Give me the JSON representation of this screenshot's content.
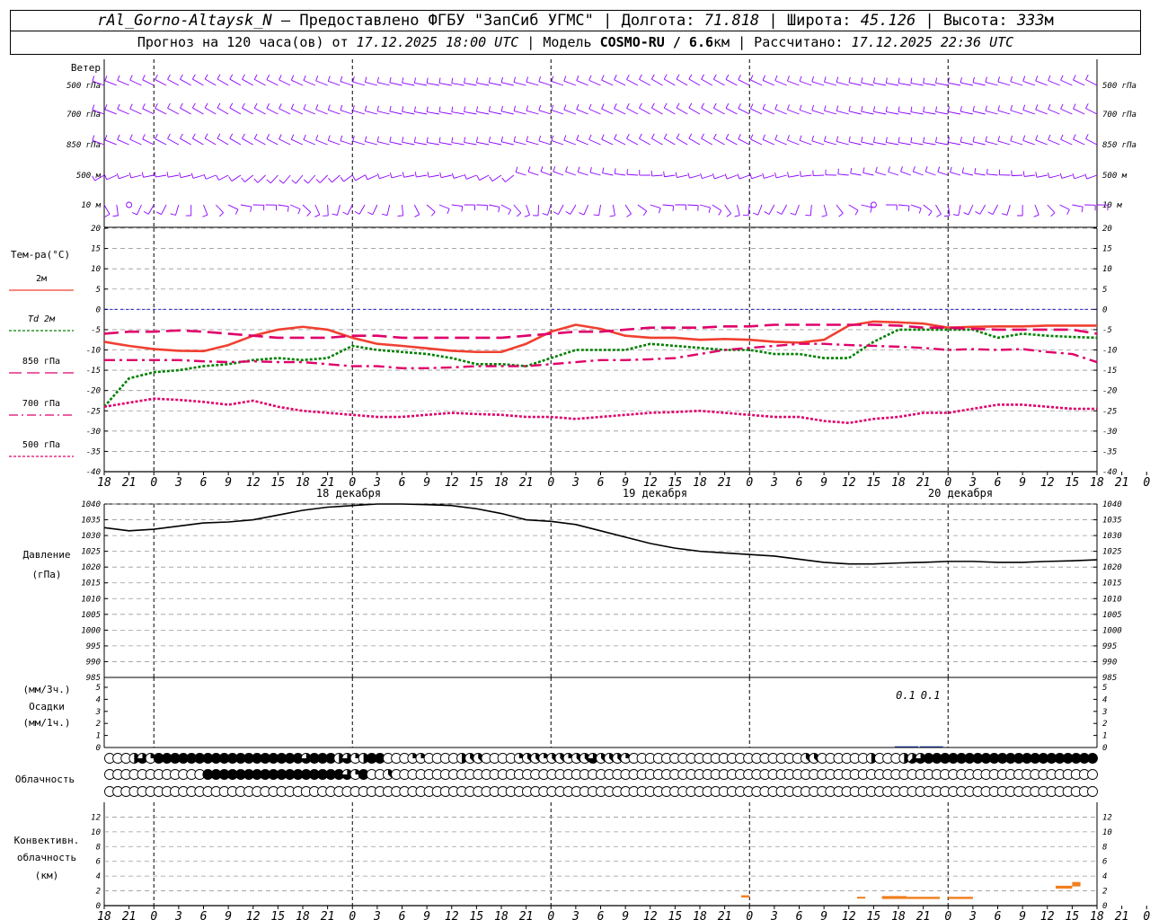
{
  "header": {
    "station": "rAl_Gorno-Altaysk_N",
    "dash": " – ",
    "provider": "Предоставлено ФГБУ \"ЗапСиб УГМС\"",
    "lon_label": "Долгота: ",
    "lon_value": "71.818",
    "lat_label": "Широта: ",
    "lat_value": "45.126",
    "alt_label": "Высота: ",
    "alt_value": "333",
    "alt_unit": "м",
    "sep": " | ",
    "forecast_prefix": "Прогноз на 120 часа(ов) от ",
    "forecast_start": "17.12.2025 18:00 UTC",
    "model_prefix": "  | Модель ",
    "model_name": "COSMO-RU / 6.6",
    "model_unit": "км",
    "calc_prefix": " | Рассчитано: ",
    "calc_time": "17.12.2025 22:36 UTC"
  },
  "colors": {
    "wind": "#8b00ff",
    "t2m": "#f04030",
    "td2m": "#008000",
    "t850": "#e0006a",
    "t700": "#e0006a",
    "t500": "#e0006a",
    "pressure": "#000000",
    "precip": "#2040c0",
    "conv": "#f08020",
    "grid": "#999999",
    "zero": "#0000cc"
  },
  "chart_data": [
    {
      "type": "wind_barbs",
      "panel_label": "Ветер",
      "levels": [
        "500 гПа",
        "700 гПа",
        "850 гПа",
        "500 м",
        "10  м"
      ]
    },
    {
      "type": "line",
      "panel_label": "Тем-ра(°С)",
      "ylim": [
        -40,
        20
      ],
      "yticks": [
        20,
        15,
        10,
        5,
        0,
        -5,
        -10,
        -15,
        -20,
        -25,
        -30,
        -35,
        -40
      ],
      "x_hours": [
        0,
        3,
        6,
        9,
        12,
        15,
        18,
        21,
        24,
        27,
        30,
        33,
        36,
        39,
        42,
        45,
        48,
        51,
        54,
        57,
        60,
        63,
        66,
        69,
        72,
        75,
        78,
        81,
        84,
        87,
        90,
        93,
        96,
        99,
        102,
        105,
        108,
        111,
        114,
        117,
        120
      ],
      "series": [
        {
          "name": "2м",
          "key": "t2m",
          "values": [
            -8,
            -9,
            -9.8,
            -10.2,
            -10.3,
            -8.8,
            -6.5,
            -5,
            -4.3,
            -5,
            -7,
            -8.5,
            -9,
            -9.6,
            -10.2,
            -10.5,
            -10.5,
            -8.5,
            -5.5,
            -3.8,
            -4.8,
            -6.5,
            -7,
            -7,
            -7.5,
            -7.3,
            -7.5,
            -8,
            -8.2,
            -7.5,
            -4,
            -3,
            -3.2,
            -3.5,
            -4.5,
            -4.3,
            -4.2,
            -4.2,
            -4,
            -4,
            -4
          ]
        },
        {
          "name": "Td  2м",
          "key": "td2m",
          "values": [
            -24,
            -17,
            -15.5,
            -15,
            -14,
            -13.5,
            -12.5,
            -12,
            -12.5,
            -12,
            -9,
            -10,
            -10.5,
            -11,
            -12,
            -13.5,
            -13.5,
            -14,
            -12,
            -10,
            -10,
            -10,
            -8.5,
            -9,
            -9.5,
            -10,
            -10,
            -11,
            -11,
            -12,
            -12,
            -8,
            -5,
            -5,
            -5,
            -5,
            -7,
            -6,
            -6.5,
            -6.8,
            -7
          ]
        },
        {
          "name": "850 гПа",
          "key": "t850",
          "values": [
            -6,
            -5.5,
            -5.5,
            -5.2,
            -5.5,
            -6,
            -6.5,
            -7,
            -7,
            -7,
            -6.5,
            -6.5,
            -7,
            -7,
            -7,
            -7,
            -7,
            -6.5,
            -6,
            -5.5,
            -5.5,
            -5,
            -4.5,
            -4.5,
            -4.5,
            -4.2,
            -4.2,
            -3.8,
            -3.8,
            -3.8,
            -3.8,
            -3.8,
            -4,
            -4.5,
            -4.5,
            -4.8,
            -5,
            -5,
            -5,
            -5,
            -6
          ]
        },
        {
          "name": "700 гПа",
          "key": "t700",
          "values": [
            -12.5,
            -12.5,
            -12.5,
            -12.5,
            -12.8,
            -13,
            -12.8,
            -13,
            -13,
            -13.5,
            -14,
            -14,
            -14.5,
            -14.5,
            -14.3,
            -14,
            -14,
            -14,
            -13.5,
            -13,
            -12.5,
            -12.5,
            -12.3,
            -12,
            -11,
            -10,
            -9.5,
            -9,
            -8.5,
            -8.5,
            -8.8,
            -9,
            -9.2,
            -9.5,
            -10,
            -9.8,
            -10,
            -9.8,
            -10.5,
            -11,
            -13
          ]
        },
        {
          "name": "500 гПа",
          "key": "t500",
          "values": [
            -24,
            -23,
            -22,
            -22.3,
            -22.8,
            -23.5,
            -22.5,
            -24,
            -25,
            -25.5,
            -26,
            -26.5,
            -26.5,
            -26,
            -25.5,
            -25.8,
            -26,
            -26.5,
            -26.5,
            -27,
            -26.5,
            -26,
            -25.5,
            -25.3,
            -25,
            -25.5,
            -26,
            -26.5,
            -26.5,
            -27.5,
            -28,
            -27,
            -26.5,
            -25.5,
            -25.5,
            -24.5,
            -23.5,
            -23.5,
            -24,
            -24.5,
            -24.5
          ]
        }
      ]
    },
    {
      "type": "line",
      "panel_label": "Давление",
      "panel_unit": "(гПа)",
      "ylim": [
        985,
        1040
      ],
      "yticks": [
        1040,
        1035,
        1030,
        1025,
        1020,
        1015,
        1010,
        1005,
        1000,
        995,
        990,
        985
      ],
      "x_hours": [
        0,
        3,
        6,
        9,
        12,
        15,
        18,
        21,
        24,
        27,
        30,
        33,
        36,
        39,
        42,
        45,
        48,
        51,
        54,
        57,
        60,
        63,
        66,
        69,
        72,
        75,
        78,
        81,
        84,
        87,
        90,
        93,
        96,
        99,
        102,
        105,
        108,
        111,
        114,
        117,
        120
      ],
      "series": [
        {
          "name": "pressure",
          "key": "pressure",
          "values": [
            1032.5,
            1031.5,
            1032,
            1033,
            1034,
            1034.3,
            1035,
            1036.5,
            1038,
            1039,
            1039.5,
            1040,
            1040,
            1039.8,
            1039.5,
            1038.5,
            1037,
            1035,
            1034.5,
            1033.5,
            1031.5,
            1029.5,
            1027.5,
            1026,
            1025,
            1024.5,
            1024,
            1023.5,
            1022.5,
            1021.5,
            1021,
            1021,
            1021.3,
            1021.5,
            1021.8,
            1021.8,
            1021.5,
            1021.5,
            1021.8,
            1022,
            1022.3
          ]
        }
      ]
    },
    {
      "type": "bar",
      "panel_label_1": "(мм/3ч.)",
      "panel_label_2": "Осадки",
      "panel_label_3": "(мм/1ч.)",
      "ylim": [
        0,
        5
      ],
      "yticks": [
        5,
        4,
        3,
        2,
        1,
        0
      ],
      "x_hours": [
        96,
        99
      ],
      "values": [
        0.1,
        0.1
      ],
      "labels": [
        "0.1",
        "0.1"
      ]
    },
    {
      "type": "cloud_cover",
      "panel_label": "Облачность",
      "rows_note": "octas per hour, 3 levels",
      "rows": [
        [
          0,
          0,
          0,
          4,
          6,
          2,
          8,
          8,
          8,
          8,
          8,
          8,
          8,
          8,
          8,
          8,
          8,
          8,
          8,
          8,
          8,
          8,
          8,
          8,
          6,
          8,
          8,
          8,
          4,
          6,
          2,
          4,
          8,
          8,
          0,
          0,
          0,
          2,
          2,
          0,
          0,
          0,
          0,
          4,
          3,
          3,
          0,
          0,
          0,
          0,
          2,
          3,
          3,
          2,
          3,
          3,
          2,
          3,
          3,
          6,
          3,
          3,
          3,
          2,
          0,
          0,
          0,
          0,
          0,
          0,
          0,
          0,
          0,
          0,
          0,
          0,
          0,
          0,
          0,
          0,
          0,
          0,
          0,
          0,
          0,
          3,
          3,
          0,
          0,
          0,
          0,
          0,
          0,
          4,
          0,
          0,
          0,
          4,
          5,
          6,
          8,
          8,
          8,
          8,
          8,
          8,
          8,
          8,
          8,
          8,
          8,
          8,
          8,
          8,
          8,
          8,
          8,
          8,
          8,
          8,
          8
        ],
        [
          0,
          0,
          0,
          0,
          0,
          0,
          0,
          0,
          0,
          0,
          0,
          0,
          8,
          8,
          8,
          8,
          8,
          8,
          8,
          8,
          8,
          8,
          8,
          8,
          8,
          8,
          8,
          8,
          8,
          6,
          2,
          8,
          0,
          0,
          3,
          0,
          0,
          0,
          0,
          0,
          0,
          0,
          0,
          0,
          0,
          0,
          0,
          0,
          0,
          0,
          0,
          0,
          0,
          0,
          0,
          0,
          0,
          0,
          0,
          0,
          0,
          0,
          0,
          0,
          0,
          0,
          0,
          0,
          0,
          0,
          0,
          0,
          0,
          0,
          0,
          0,
          0,
          0,
          0,
          0,
          0,
          0,
          0,
          0,
          0,
          0,
          0,
          0,
          0,
          0,
          0,
          0,
          0,
          0,
          0,
          0,
          0,
          0,
          0,
          0,
          0,
          0,
          0,
          0,
          0,
          0,
          0,
          0,
          0,
          0,
          0,
          0,
          0,
          0,
          0,
          0,
          0,
          0,
          0,
          0,
          0
        ],
        [
          0,
          0,
          0,
          0,
          0,
          0,
          0,
          0,
          0,
          0,
          0,
          0,
          0,
          0,
          0,
          0,
          0,
          0,
          0,
          0,
          0,
          0,
          0,
          0,
          0,
          0,
          0,
          0,
          0,
          0,
          0,
          0,
          0,
          0,
          0,
          0,
          0,
          0,
          0,
          0,
          0,
          0,
          0,
          0,
          0,
          0,
          0,
          0,
          0,
          0,
          0,
          0,
          0,
          0,
          0,
          0,
          0,
          0,
          0,
          0,
          0,
          0,
          0,
          0,
          0,
          0,
          0,
          0,
          0,
          0,
          0,
          0,
          0,
          0,
          0,
          0,
          0,
          0,
          0,
          0,
          0,
          0,
          0,
          0,
          0,
          0,
          0,
          0,
          0,
          0,
          0,
          0,
          0,
          0,
          0,
          0,
          0,
          0,
          0,
          0,
          0,
          0,
          0,
          0,
          0,
          0,
          0,
          0,
          0,
          0,
          0,
          0,
          0,
          0,
          0,
          0,
          0,
          0,
          0,
          0,
          0
        ]
      ]
    },
    {
      "type": "bar",
      "panel_label_1": "Конвективн.",
      "panel_label_2": "облачность",
      "panel_label_3": "(км)",
      "ylim": [
        0,
        14
      ],
      "yticks": [
        12,
        10,
        8,
        6,
        4,
        2,
        0
      ],
      "segments": [
        {
          "x0": 77,
          "x1": 78,
          "bottom": 1.1,
          "top": 1.4
        },
        {
          "x0": 91,
          "x1": 92,
          "bottom": 1.0,
          "top": 1.2
        },
        {
          "x0": 94,
          "x1": 97,
          "bottom": 0.9,
          "top": 1.3
        },
        {
          "x0": 97,
          "x1": 101,
          "bottom": 0.9,
          "top": 1.2
        },
        {
          "x0": 102,
          "x1": 105,
          "bottom": 0.9,
          "top": 1.2
        },
        {
          "x0": 115,
          "x1": 117,
          "bottom": 2.3,
          "top": 2.7
        },
        {
          "x0": 117,
          "x1": 118,
          "bottom": 2.6,
          "top": 3.2
        }
      ]
    }
  ],
  "axis": {
    "hour_labels": [
      "18",
      "21",
      "0",
      "3",
      "6",
      "9",
      "12",
      "15",
      "18",
      "21",
      "0",
      "3",
      "6",
      "9",
      "12",
      "15",
      "18",
      "21",
      "0",
      "3",
      "6",
      "9",
      "12",
      "15",
      "18",
      "21",
      "0",
      "3",
      "6",
      "9",
      "12",
      "15",
      "18",
      "21",
      "0",
      "3",
      "6",
      "9",
      "12",
      "15",
      "18",
      "21",
      "0"
    ],
    "day_labels": [
      "18 декабря",
      "19 декабря",
      "20 декабря"
    ]
  }
}
